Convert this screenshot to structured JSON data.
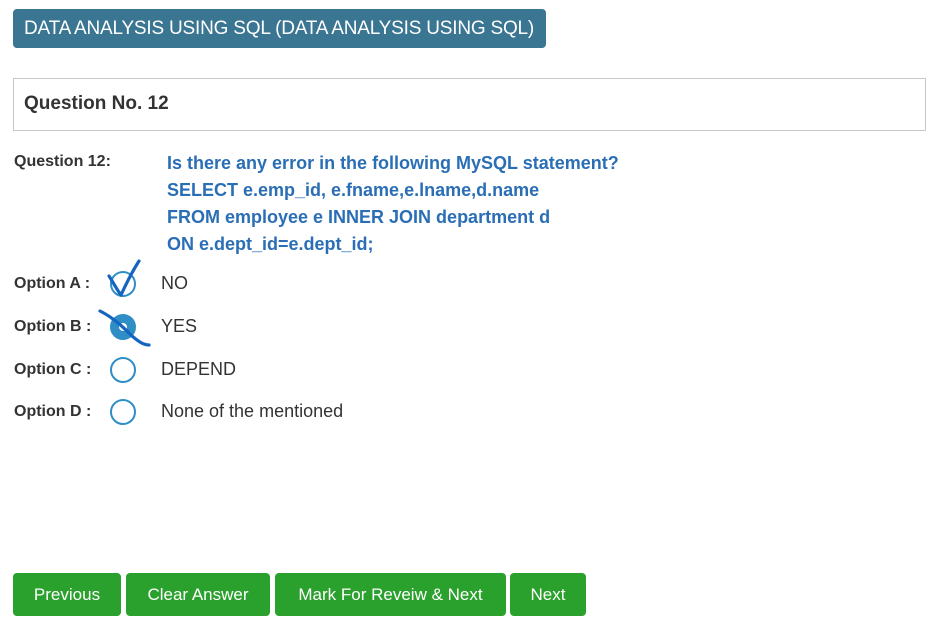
{
  "header": {
    "course_title": "DATA ANALYSIS USING SQL (DATA ANALYSIS USING SQL)"
  },
  "question": {
    "heading": "Question No. 12",
    "label": "Question 12:",
    "text_lines": [
      "Is there any error in the following MySQL statement?",
      "SELECT e.emp_id, e.fname,e.lname,d.name",
      "FROM employee e INNER JOIN department d",
      "ON e.dept_id=e.dept_id;"
    ]
  },
  "options": [
    {
      "label": "Option A :",
      "text": "NO",
      "selected": false
    },
    {
      "label": "Option B :",
      "text": "YES",
      "selected": true
    },
    {
      "label": "Option C :",
      "text": "DEPEND",
      "selected": false
    },
    {
      "label": "Option D :",
      "text": "None of the mentioned",
      "selected": false
    }
  ],
  "buttons": {
    "previous": "Previous",
    "clear": "Clear Answer",
    "mark_review": "Mark For Reveiw & Next",
    "next": "Next"
  },
  "annotations": {
    "check_mark_color": "#1565c0",
    "cross_mark_color": "#1565c0"
  },
  "colors": {
    "badge_bg": "#3a7592",
    "question_text": "#2a6eb5",
    "radio": "#2f8ec6",
    "button_bg": "#2aa12c"
  }
}
